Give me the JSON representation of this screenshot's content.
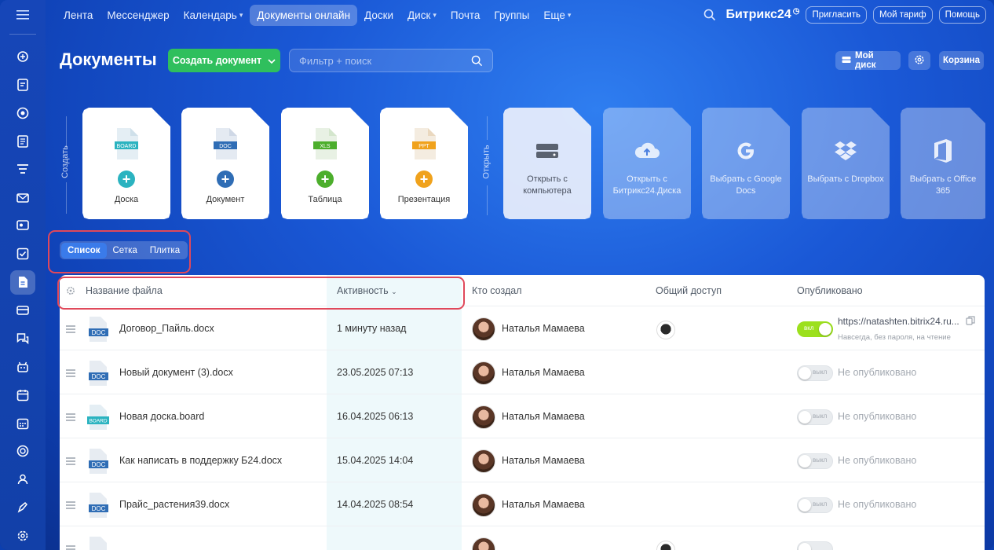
{
  "topnav": {
    "menu_icon": "hamburger-icon",
    "items": [
      {
        "label": "Лента",
        "active": false,
        "dropdown": false
      },
      {
        "label": "Мессенджер",
        "active": false,
        "dropdown": false
      },
      {
        "label": "Календарь",
        "active": false,
        "dropdown": true
      },
      {
        "label": "Документы онлайн",
        "active": true,
        "dropdown": false
      },
      {
        "label": "Доски",
        "active": false,
        "dropdown": false
      },
      {
        "label": "Диск",
        "active": false,
        "dropdown": true
      },
      {
        "label": "Почта",
        "active": false,
        "dropdown": false
      },
      {
        "label": "Группы",
        "active": false,
        "dropdown": false
      },
      {
        "label": "Еще",
        "active": false,
        "dropdown": true
      }
    ],
    "brand": "Битрикс24",
    "invite_label": "Пригласить",
    "tariff_label": "Мой тариф",
    "help_label": "Помощь"
  },
  "page": {
    "title": "Документы",
    "create_button": "Создать документ",
    "search_placeholder": "Фильтр + поиск",
    "my_disk_label": "Мой диск",
    "trash_label": "Корзина"
  },
  "create_section": {
    "label": "Создать",
    "cards": [
      {
        "label": "Доска",
        "badge": "BOARD",
        "badge_color": "#2bb3c0",
        "plus_color": "#2bb3c0"
      },
      {
        "label": "Документ",
        "badge": "DOC",
        "badge_color": "#2f6db5",
        "plus_color": "#2f6db5"
      },
      {
        "label": "Таблица",
        "badge": "XLS",
        "badge_color": "#4cae2c",
        "plus_color": "#4cae2c"
      },
      {
        "label": "Презентация",
        "badge": "PPT",
        "badge_color": "#f0a21c",
        "plus_color": "#f0a21c"
      }
    ]
  },
  "open_section": {
    "label": "Открыть",
    "cards": [
      {
        "label": "Открыть с компьютера",
        "icon": "computer-drive-icon"
      },
      {
        "label": "Открыть с Битрикс24.Диска",
        "icon": "cloud-upload-icon"
      },
      {
        "label": "Выбрать с Google Docs",
        "icon": "google-icon"
      },
      {
        "label": "Выбрать с Dropbox",
        "icon": "dropbox-icon"
      },
      {
        "label": "Выбрать с Office 365",
        "icon": "office-icon"
      }
    ]
  },
  "view_switch": {
    "options": [
      "Список",
      "Сетка",
      "Плитка"
    ],
    "active": "Список"
  },
  "table": {
    "columns": {
      "name": "Название файла",
      "activity": "Активность",
      "author": "Кто создал",
      "sharing": "Общий доступ",
      "published": "Опубликовано"
    },
    "toggle_on": "вкл",
    "toggle_off": "выкл",
    "rows": [
      {
        "name": "Договор_Пайль.docx",
        "type": "DOC",
        "activity": "1 минуту назад",
        "author": "Наталья Мамаева",
        "shared": true,
        "published": true,
        "link": "https://natashten.bitrix24.ru...",
        "link_note": "Навсегда, без пароля, на чтение"
      },
      {
        "name": "Новый документ (3).docx",
        "type": "DOC",
        "activity": "23.05.2025 07:13",
        "author": "Наталья Мамаева",
        "shared": false,
        "published": false,
        "status": "Не опубликовано"
      },
      {
        "name": "Новая доска.board",
        "type": "BOARD",
        "activity": "16.04.2025 06:13",
        "author": "Наталья Мамаева",
        "shared": false,
        "published": false,
        "status": "Не опубликовано"
      },
      {
        "name": "Как написать в поддержку Б24.docx",
        "type": "DOC",
        "activity": "15.04.2025 14:04",
        "author": "Наталья Мамаева",
        "shared": false,
        "published": false,
        "status": "Не опубликовано"
      },
      {
        "name": "Прайс_растения39.docx",
        "type": "DOC",
        "activity": "14.04.2025 08:54",
        "author": "Наталья Мамаева",
        "shared": false,
        "published": false,
        "status": "Не опубликовано"
      }
    ]
  },
  "rail_icons": [
    "hamburger-icon",
    "activity-icon",
    "tasks-icon",
    "crm-icon",
    "docs-list-icon",
    "filter-icon",
    "mail-icon",
    "chat-board-icon",
    "check-icon",
    "document-icon",
    "card-icon",
    "messages-icon",
    "robot-icon",
    "calendar-icon",
    "planner-icon",
    "goals-icon",
    "team-icon",
    "edit-icon",
    "settings-icon"
  ]
}
